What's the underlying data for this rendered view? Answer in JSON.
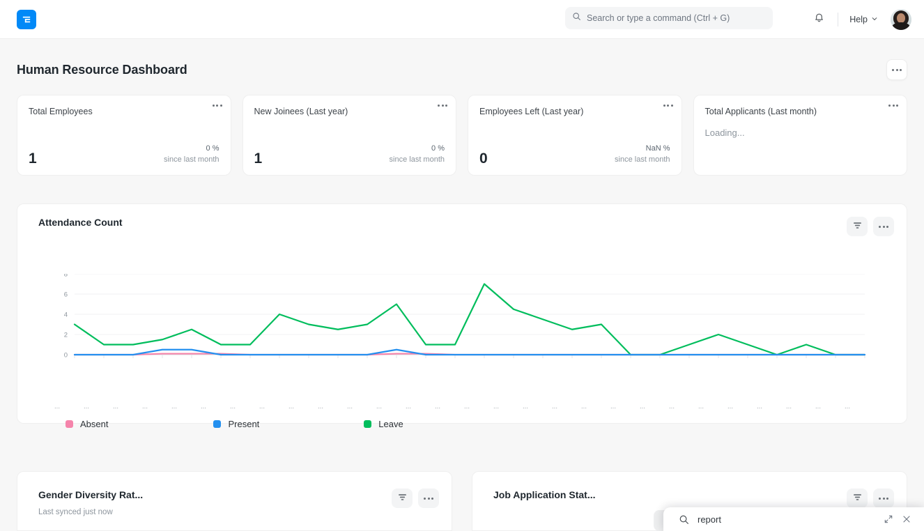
{
  "navbar": {
    "logo_icon": "erpnext-logo-icon",
    "search": {
      "placeholder": "Search or type a command (Ctrl + G)",
      "icon": "search-icon"
    },
    "notifications_icon": "bell-icon",
    "help_label": "Help",
    "help_chevron_icon": "chevron-down-icon",
    "avatar": "user-avatar"
  },
  "page": {
    "title": "Human Resource Dashboard",
    "menu_icon": "ellipsis-icon"
  },
  "number_cards": [
    {
      "title": "Total Employees",
      "value": "1",
      "percent": "0 %",
      "since": "since last month",
      "loading": null
    },
    {
      "title": "New Joinees (Last year)",
      "value": "1",
      "percent": "0 %",
      "since": "since last month",
      "loading": null
    },
    {
      "title": "Employees Left (Last year)",
      "value": "0",
      "percent": "NaN %",
      "since": "since last month",
      "loading": null
    },
    {
      "title": "Total Applicants (Last month)",
      "value": null,
      "percent": null,
      "since": null,
      "loading": "Loading..."
    }
  ],
  "attendance_card": {
    "title": "Attendance Count",
    "filter_icon": "filter-icon",
    "menu_icon": "ellipsis-icon"
  },
  "bottom_cards": [
    {
      "title": "Gender Diversity Rat...",
      "subtitle": "Last synced just now",
      "filter_icon": "filter-icon",
      "menu_icon": "ellipsis-icon"
    },
    {
      "title": "Job Application Stat...",
      "subtitle": "",
      "filter_icon": "filter-icon",
      "menu_icon": "ellipsis-icon"
    }
  ],
  "search_overlay": {
    "query": "report",
    "search_icon": "search-icon",
    "expand_icon": "expand-diagonal-icon",
    "close_icon": "close-icon"
  },
  "colors": {
    "absent": "#F584AB",
    "present": "#2490EF",
    "leave": "#00BD5C",
    "brand": "#0289F7",
    "text": "#1F272E",
    "muted": "#8D959D",
    "page_bg": "#F7F7F7",
    "card_bg": "#FFFFFF"
  },
  "chart_data": {
    "type": "line",
    "title": "Attendance Count",
    "xlabel": "",
    "ylabel": "",
    "ylim": [
      0,
      8
    ],
    "yticks": [
      0,
      2,
      4,
      6,
      8
    ],
    "grid": true,
    "legend_position": "bottom-left",
    "categories": [
      "...",
      "...",
      "...",
      "...",
      "...",
      "...",
      "...",
      "...",
      "...",
      "...",
      "...",
      "...",
      "...",
      "...",
      "...",
      "...",
      "...",
      "...",
      "...",
      "...",
      "...",
      "...",
      "...",
      "...",
      "...",
      "...",
      "...",
      "..."
    ],
    "series": [
      {
        "name": "Absent",
        "color": "#F584AB",
        "values": [
          0,
          0,
          0,
          0.1,
          0.1,
          0.1,
          0,
          0,
          0,
          0,
          0,
          0.1,
          0.1,
          0,
          0,
          0,
          0,
          0,
          0,
          0,
          0,
          0,
          0,
          0,
          0,
          0,
          0,
          0
        ]
      },
      {
        "name": "Present",
        "color": "#2490EF",
        "values": [
          0,
          0,
          0,
          0.5,
          0.5,
          0,
          0,
          0,
          0,
          0,
          0,
          0.5,
          0,
          0,
          0,
          0,
          0,
          0,
          0,
          0,
          0,
          0,
          0,
          0,
          0,
          0,
          0,
          0
        ]
      },
      {
        "name": "Leave",
        "color": "#00BD5C",
        "values": [
          3,
          1,
          1,
          1.5,
          2.5,
          1,
          1,
          4,
          3,
          2.5,
          3,
          5,
          1,
          1,
          7,
          4.5,
          3.5,
          2.5,
          3,
          0,
          0,
          1,
          2,
          1,
          0,
          1,
          0,
          0
        ]
      }
    ]
  }
}
